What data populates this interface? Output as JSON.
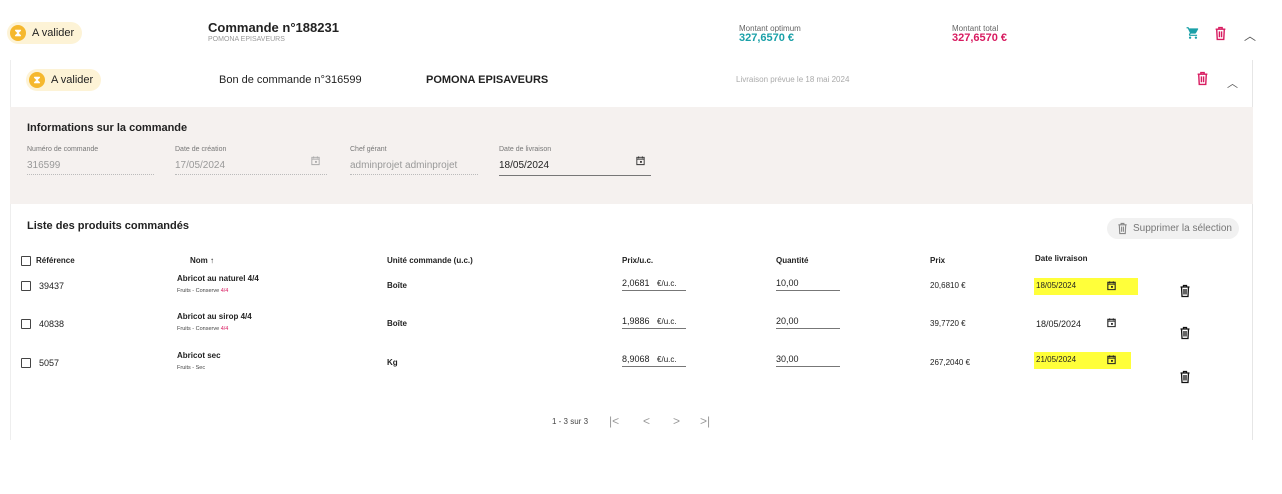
{
  "order": {
    "status": "A valider",
    "title": "Commande n°188231",
    "supplier": "POMONA EPISAVEURS",
    "optimum_label": "Montant optimum",
    "optimum_value": "327,6570 €",
    "total_label": "Montant total",
    "total_value": "327,6570 €"
  },
  "purchase": {
    "status": "A valider",
    "title": "Bon de commande n°316599",
    "supplier": "POMONA EPISAVEURS",
    "delivery": "Livraison prévue le 18 mai 2024"
  },
  "info": {
    "heading": "Informations sur la commande",
    "fields": [
      {
        "label": "Numéro de commande",
        "value": "316599"
      },
      {
        "label": "Date de création",
        "value": "17/05/2024"
      },
      {
        "label": "Chef gérant",
        "value": "adminprojet adminprojet"
      },
      {
        "label": "Date de livraison",
        "value": "18/05/2024"
      }
    ]
  },
  "products": {
    "heading": "Liste des produits commandés",
    "delete_selection": "Supprimer la sélection",
    "columns": {
      "ref": "Référence",
      "name": "Nom ↑",
      "unit": "Unité commande (u.c.)",
      "price_unit": "Prix/u.c.",
      "qty": "Quantité",
      "price": "Prix",
      "date": "Date livraison"
    },
    "rows": [
      {
        "ref": "39437",
        "name": "Abricot au naturel 4/4",
        "cat": "Fruits - Conserve ",
        "cat_accent": "4/4",
        "unit": "Boîte",
        "price_unit": "2,0681",
        "unit_suffix": "€/u.c.",
        "qty": "10,00",
        "price": "20,6810 €",
        "date": "18/05/2024",
        "highlight": true
      },
      {
        "ref": "40838",
        "name": "Abricot au sirop 4/4",
        "cat": "Fruits - Conserve ",
        "cat_accent": "4/4",
        "unit": "Boîte",
        "price_unit": "1,9886",
        "unit_suffix": "€/u.c.",
        "qty": "20,00",
        "price": "39,7720 €",
        "date": "18/05/2024",
        "highlight": false
      },
      {
        "ref": "5057",
        "name": "Abricot sec",
        "cat": "Fruits - Sec",
        "cat_accent": "",
        "unit": "Kg",
        "price_unit": "8,9068",
        "unit_suffix": "€/u.c.",
        "qty": "30,00",
        "price": "267,2040 €",
        "date": "21/05/2024",
        "highlight": true
      }
    ],
    "pagination": "1 - 3 sur 3"
  },
  "icons": {
    "status": "hourglass-icon",
    "cart": "cart-icon",
    "trash": "trash-icon",
    "collapse": "chevron-up-icon",
    "calendar": "calendar-icon",
    "pager": [
      "first-page-icon",
      "prev-page-icon",
      "next-page-icon",
      "last-page-icon"
    ]
  },
  "colors": {
    "teal": "#1aa0a8",
    "pink": "#d81b60",
    "badge_bg": "#fdf3d6",
    "highlight": "#ffff3a",
    "section_bg": "#f5f1ef"
  }
}
